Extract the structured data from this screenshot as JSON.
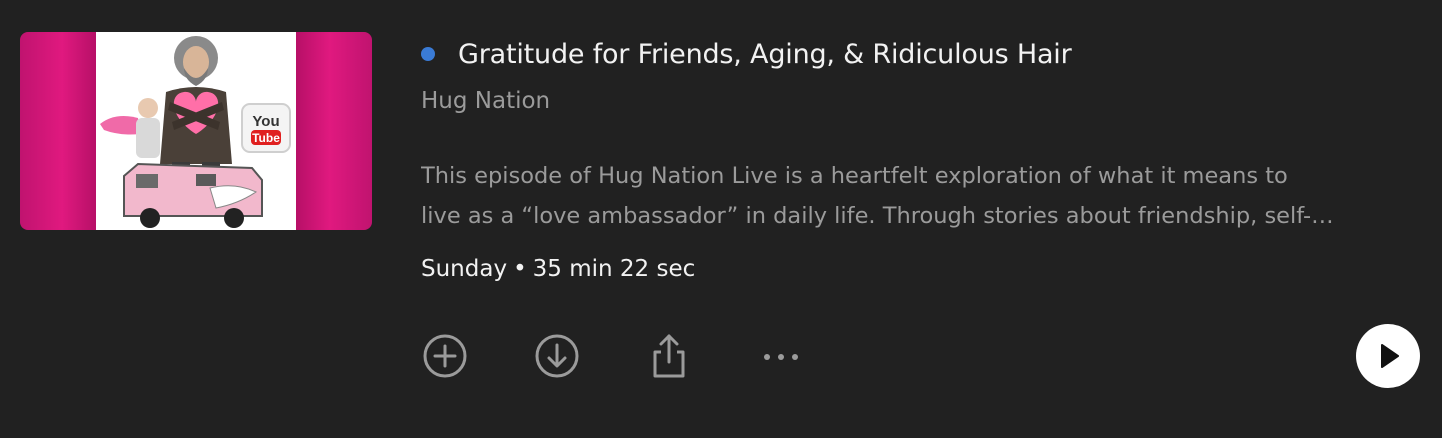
{
  "episode": {
    "title": "Gratitude for Friends, Aging, & Ridiculous Hair",
    "show": "Hug Nation",
    "description_line1": "This episode of Hug Nation Live is a heartfelt exploration of what it means to",
    "description_line2": "live as a “love ambassador” in daily life. Through stories about friendship, self-…",
    "day": "Sunday",
    "separator": "•",
    "duration": "35 min 22 sec",
    "unplayed": true
  },
  "artwork": {
    "badge_line1": "You",
    "badge_line2": "Tube"
  },
  "actions": [
    {
      "icon": "plus-circle-icon",
      "name": "add-to-library-button"
    },
    {
      "icon": "download-circle-icon",
      "name": "download-button"
    },
    {
      "icon": "share-icon",
      "name": "share-button"
    },
    {
      "icon": "more-horizontal-icon",
      "name": "more-options-button"
    }
  ],
  "play": {
    "icon": "play-icon"
  },
  "colors": {
    "background": "#212121",
    "unplayed_dot": "#3a7bd5",
    "artwork_accent": "#e0197f",
    "primary_text": "#f2f2f2",
    "secondary_text": "#9b9b9b",
    "icon": "#9b9b9b",
    "play_button": "#ffffff"
  }
}
